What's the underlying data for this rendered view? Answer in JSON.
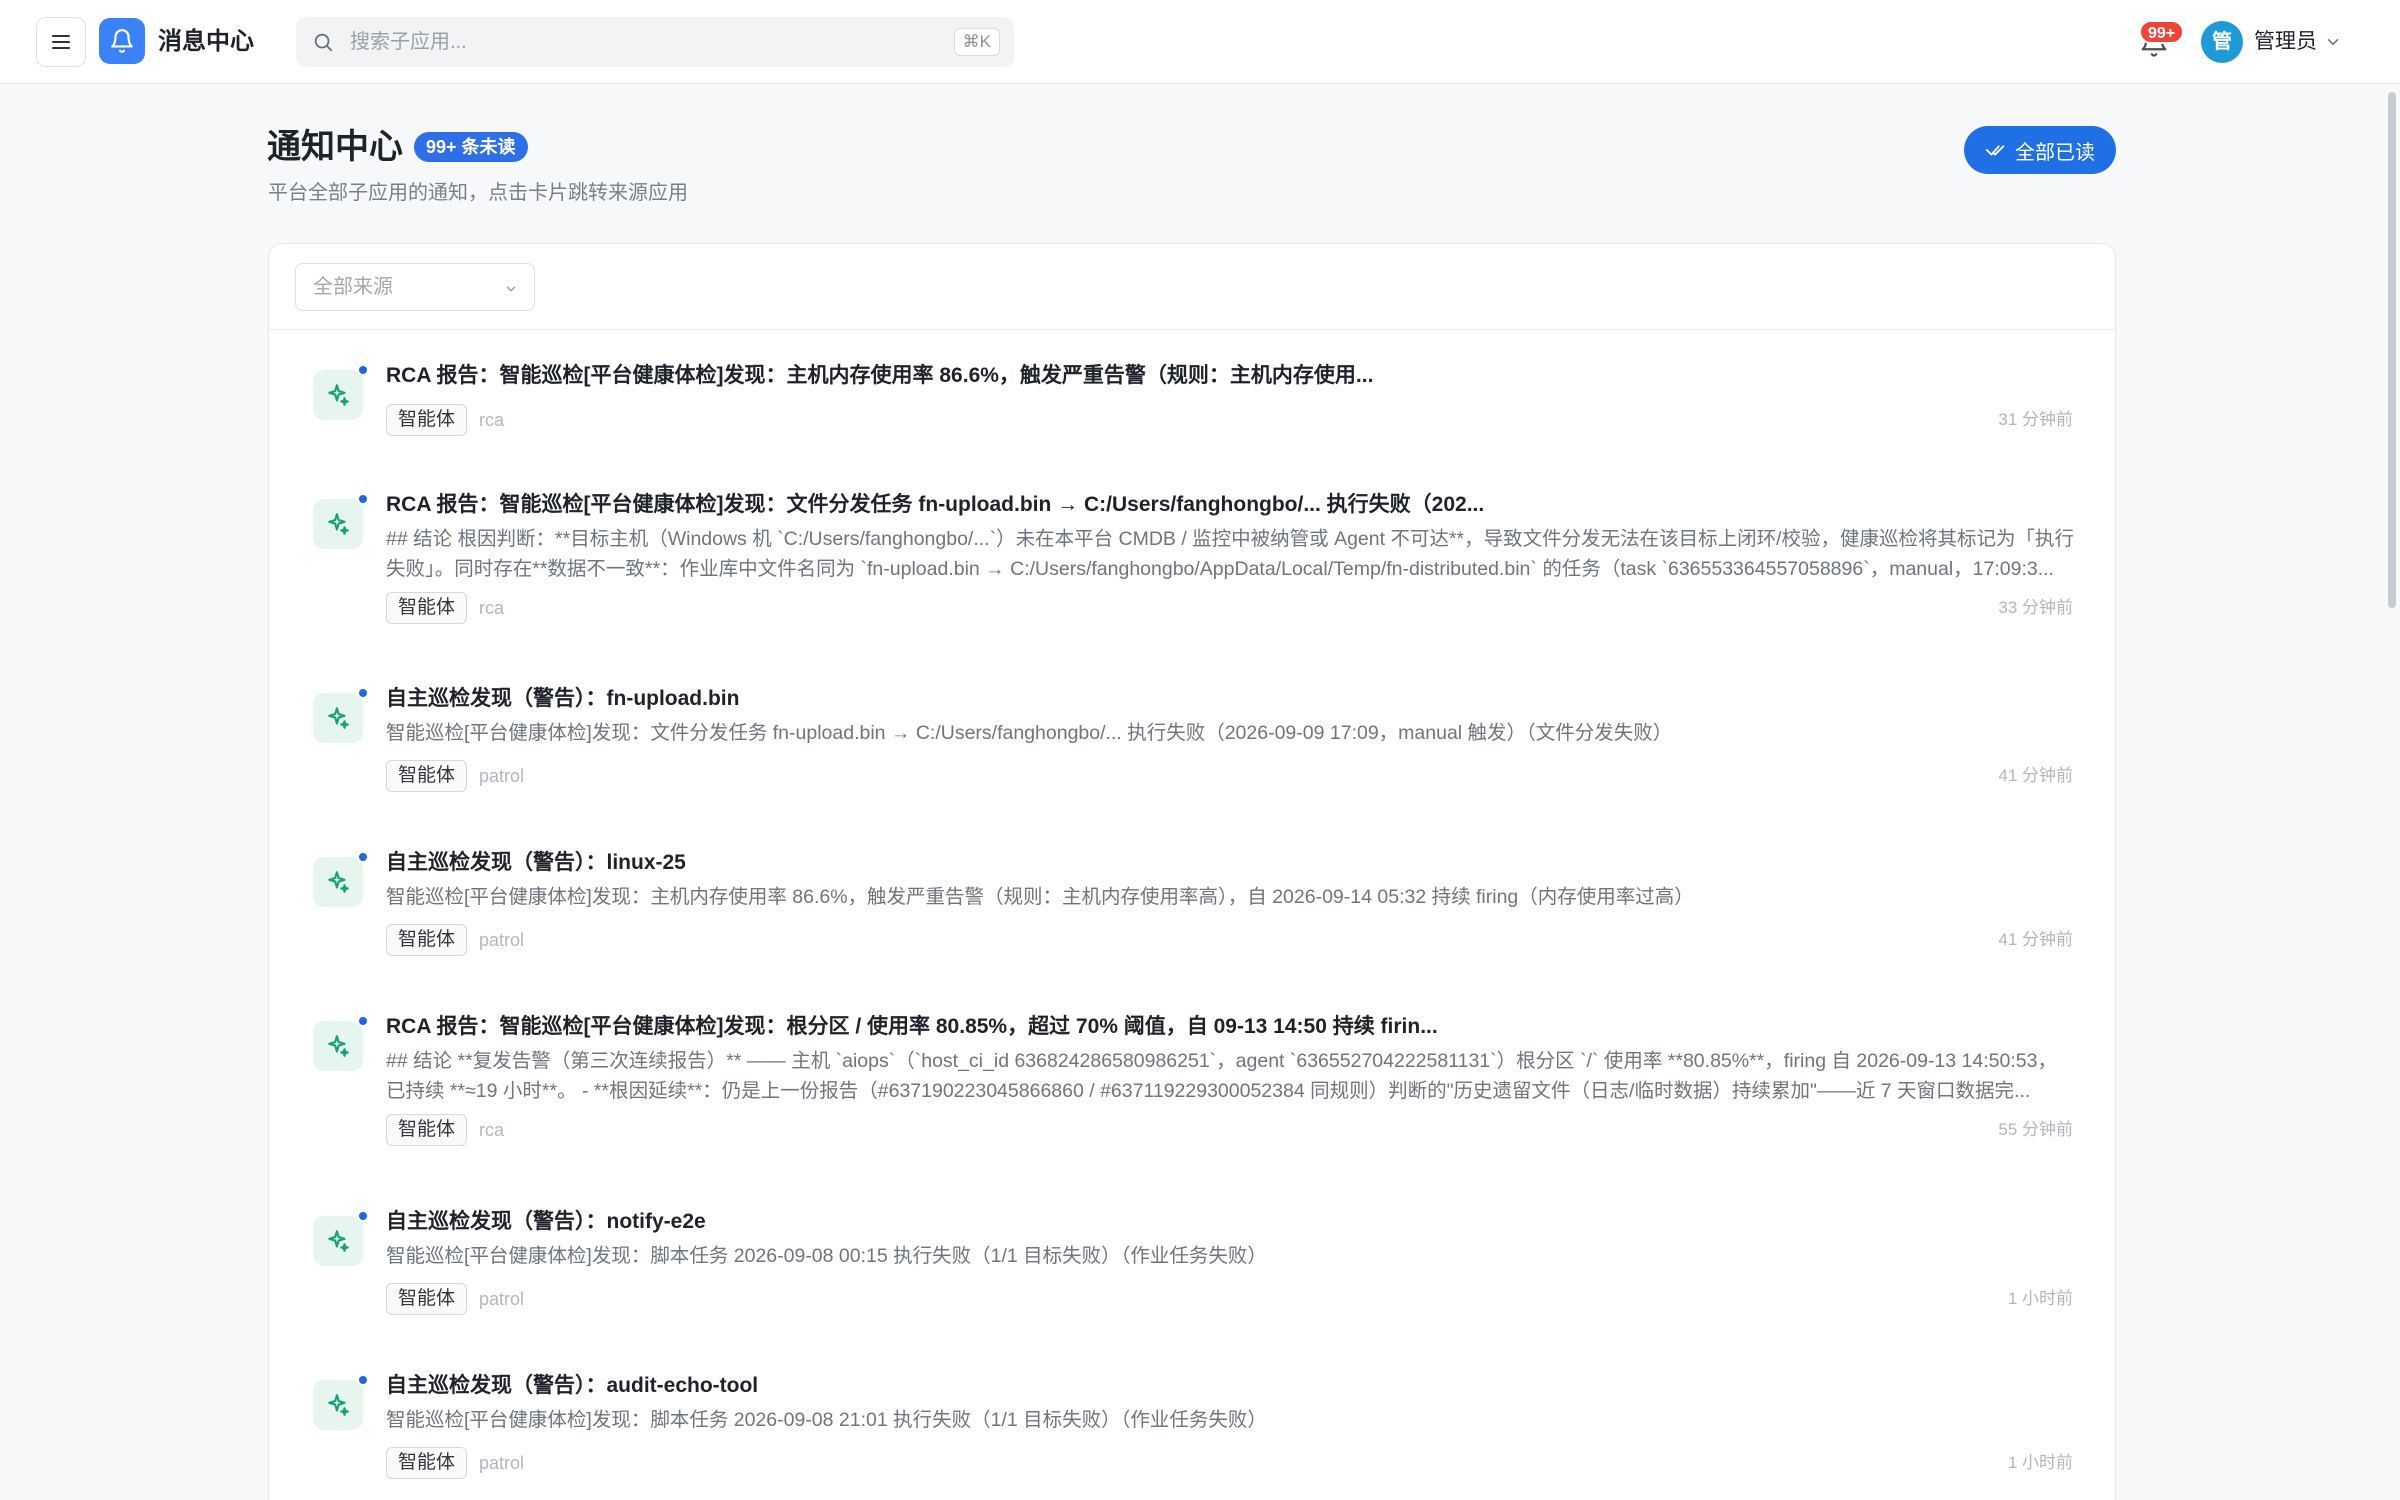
{
  "header": {
    "app_title": "消息中心",
    "search_placeholder": "搜索子应用...",
    "search_shortcut": "⌘K",
    "notification_badge": "99+",
    "user_avatar_text": "管",
    "user_name": "管理员",
    "icons": {
      "menu": "menu-icon",
      "app": "bell-icon",
      "search": "search-icon",
      "notifications": "bell-icon",
      "user_menu": "chevron-down-icon"
    }
  },
  "page": {
    "title": "通知中心",
    "unread_badge": "99+ 条未读",
    "subtitle": "平台全部子应用的通知，点击卡片跳转来源应用",
    "mark_all_read_label": "全部已读"
  },
  "filter": {
    "source_value": "全部来源"
  },
  "notifications": [
    {
      "title": "RCA 报告：智能巡检[平台健康体检]发现：主机内存使用率 86.6%，触发严重告警（规则：主机内存使用...",
      "body": "",
      "tag": "智能体",
      "source": "rca",
      "time": "31 分钟前",
      "unread": true
    },
    {
      "title": "RCA 报告：智能巡检[平台健康体检]发现：文件分发任务 fn-upload.bin → C:/Users/fanghongbo/... 执行失败（202...",
      "body": "## 结论 根因判断：**目标主机（Windows 机 `C:/Users/fanghongbo/...`）未在本平台 CMDB / 监控中被纳管或 Agent 不可达**，导致文件分发无法在该目标上闭环/校验，健康巡检将其标记为「执行失败」。同时存在**数据不一致**：作业库中文件名同为 `fn-upload.bin → C:/Users/fanghongbo/AppData/Local/Temp/fn-distributed.bin` 的任务（task `636553364557058896`，manual，17:09:3...",
      "tag": "智能体",
      "source": "rca",
      "time": "33 分钟前",
      "unread": true
    },
    {
      "title": "自主巡检发现（警告）：fn-upload.bin",
      "body": "智能巡检[平台健康体检]发现：文件分发任务 fn-upload.bin → C:/Users/fanghongbo/... 执行失败（2026-09-09 17:09，manual 触发）（文件分发失败）",
      "tag": "智能体",
      "source": "patrol",
      "time": "41 分钟前",
      "unread": true
    },
    {
      "title": "自主巡检发现（警告）：linux-25",
      "body": "智能巡检[平台健康体检]发现：主机内存使用率 86.6%，触发严重告警（规则：主机内存使用率高），自 2026-09-14 05:32 持续 firing（内存使用率过高）",
      "tag": "智能体",
      "source": "patrol",
      "time": "41 分钟前",
      "unread": true
    },
    {
      "title": "RCA 报告：智能巡检[平台健康体检]发现：根分区 / 使用率 80.85%，超过 70% 阈值，自 09-13 14:50 持续 firin...",
      "body": "## 结论 **复发告警（第三次连续报告）** —— 主机 `aiops`（`host_ci_id 636824286580986251`，agent `636552704222581131`）根分区 `/` 使用率 **80.85%**，firing 自 2026-09-13 14:50:53，已持续 **≈19 小时**。 - **根因延续**：仍是上一份报告（#637190223045866860 / #637119229300052384 同规则）判断的\"历史遗留文件（日志/临时数据）持续累加\"——近 7 天窗口数据完...",
      "tag": "智能体",
      "source": "rca",
      "time": "55 分钟前",
      "unread": true
    },
    {
      "title": "自主巡检发现（警告）：notify-e2e",
      "body": "智能巡检[平台健康体检]发现：脚本任务 2026-09-08 00:15 执行失败（1/1 目标失败）（作业任务失败）",
      "tag": "智能体",
      "source": "patrol",
      "time": "1 小时前",
      "unread": true
    },
    {
      "title": "自主巡检发现（警告）：audit-echo-tool",
      "body": "智能巡检[平台健康体检]发现：脚本任务 2026-09-08 21:01 执行失败（1/1 目标失败）（作业任务失败）",
      "tag": "智能体",
      "source": "patrol",
      "time": "1 小时前",
      "unread": true
    }
  ],
  "item_icon": "sparkle-icon",
  "colors": {
    "primary": "#1f6fe5",
    "badge_red": "#f04438",
    "unread_dot": "#2165e3",
    "agent_icon_bg": "#e6f6ef",
    "agent_icon_fg": "#1aa179"
  }
}
